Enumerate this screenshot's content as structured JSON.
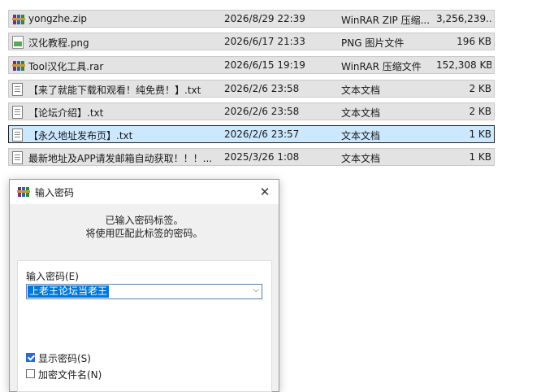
{
  "files": [
    {
      "icon": "winrar-zip-icon",
      "name": "yongzhe.zip",
      "date": "2026/8/29 22:39",
      "type": "WinRAR ZIP 压缩...",
      "size": "3,256,239..."
    },
    {
      "icon": "png-image-icon",
      "name": "汉化教程.png",
      "date": "2026/6/17 21:33",
      "type": "PNG 图片文件",
      "size": "196 KB"
    },
    {
      "icon": "winrar-archive-icon",
      "name": "Tool汉化工具.rar",
      "date": "2026/6/15 19:19",
      "type": "WinRAR 压缩文件",
      "size": "152,308 KB"
    },
    {
      "icon": "text-document-icon",
      "name": "【来了就能下载和观看！纯免费！】.txt",
      "date": "2026/2/6 23:58",
      "type": "文本文档",
      "size": "2 KB"
    },
    {
      "icon": "text-document-icon",
      "name": "【论坛介绍】.txt",
      "date": "2026/2/6 23:58",
      "type": "文本文档",
      "size": "2 KB"
    },
    {
      "icon": "text-document-icon",
      "name": "【永久地址发布页】.txt",
      "date": "2026/2/6 23:57",
      "type": "文本文档",
      "size": "1 KB"
    },
    {
      "icon": "text-document-icon",
      "name": "最新地址及APP请发邮箱自动获取！！！...",
      "date": "2025/3/26 1:08",
      "type": "文本文档",
      "size": "1 KB"
    }
  ],
  "dialog": {
    "title": "输入密码",
    "info_line1": "已输入密码标签。",
    "info_line2": "将使用匹配此标签的密码。",
    "password_label": "输入密码(E)",
    "password_value": "上老王论坛当老王",
    "show_password_label": "显示密码(S)",
    "show_password_checked": true,
    "encrypt_filenames_label": "加密文件名(N)",
    "encrypt_filenames_checked": false,
    "close_glyph": "✕"
  },
  "colors": {
    "selected_row": "#cce8ff",
    "row_bg": "#e3e3e3",
    "accent": "#0078d7"
  }
}
